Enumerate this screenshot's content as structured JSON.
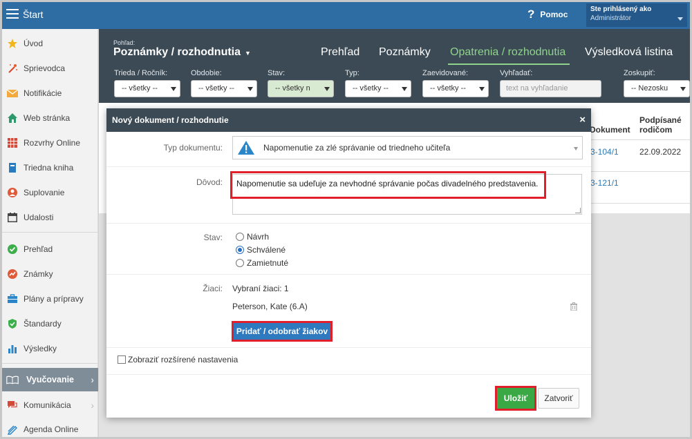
{
  "topbar": {
    "start_label": "Štart",
    "help_label": "Pomoc",
    "help_icon": "?",
    "user_line1": "Ste prihlásený ako",
    "user_line2": "Administrátor"
  },
  "sidebar": {
    "items": [
      {
        "label": "Úvod",
        "icon": "star-icon"
      },
      {
        "label": "Sprievodca",
        "icon": "wand-icon"
      },
      {
        "label": "Notifikácie",
        "icon": "envelope-icon"
      },
      {
        "label": "Web stránka",
        "icon": "house-icon"
      },
      {
        "label": "Rozvrhy Online",
        "icon": "calendar-grid-icon"
      },
      {
        "label": "Triedna kniha",
        "icon": "book-icon"
      },
      {
        "label": "Suplovanie",
        "icon": "person-swap-icon"
      },
      {
        "label": "Udalosti",
        "icon": "calendar-icon"
      },
      {
        "label": "Prehľad",
        "icon": "check-circle-icon"
      },
      {
        "label": "Známky",
        "icon": "grade-icon"
      },
      {
        "label": "Plány a prípravy",
        "icon": "briefcase-icon"
      },
      {
        "label": "Štandardy",
        "icon": "shield-check-icon"
      },
      {
        "label": "Výsledky",
        "icon": "bar-chart-icon"
      },
      {
        "label": "Vyučovanie",
        "icon": "open-book-icon"
      },
      {
        "label": "Komunikácia",
        "icon": "chat-icon"
      },
      {
        "label": "Agenda Online",
        "icon": "pen-icon"
      }
    ]
  },
  "header": {
    "view_label": "Pohľad:",
    "view_value": "Poznámky / rozhodnutia",
    "tabs": [
      "Prehľad",
      "Poznámky",
      "Opatrenia / rozhodnutia",
      "Výsledková listina"
    ],
    "active_tab": "Opatrenia / rozhodnutia",
    "filters": [
      {
        "label": "Trieda / Ročník:",
        "value": "-- všetky --"
      },
      {
        "label": "Obdobie:",
        "value": "-- všetky --"
      },
      {
        "label": "Stav:",
        "value": "-- všetky n"
      },
      {
        "label": "Typ:",
        "value": "-- všetky --"
      },
      {
        "label": "Zaevidované:",
        "value": "-- všetky --"
      }
    ],
    "search_label": "Vyhľadať:",
    "search_placeholder": "text na vyhľadanie",
    "group_label": "Zoskupiť:",
    "group_value": "-- Nezosku"
  },
  "table": {
    "col_document": "Dokument",
    "col_signed_line1": "Podpísané",
    "col_signed_line2": "rodičom",
    "rows": [
      {
        "doc": "3-104/1",
        "signed": "22.09.2022"
      },
      {
        "doc": "3-121/1",
        "signed": ""
      }
    ]
  },
  "modal": {
    "title": "Nový dokument / rozhodnutie",
    "close_icon": "×",
    "doc_type_label": "Typ dokumentu:",
    "doc_type_value": "Napomenutie za zlé správanie od triedneho učiteľa",
    "reason_label": "Dôvod:",
    "reason_value": "Napomenutie sa udeľuje za nevhodné správanie počas divadelného predstavenia.",
    "status_label": "Stav:",
    "status_options": [
      "Návrh",
      "Schválené",
      "Zamietnuté"
    ],
    "status_selected": "Schválené",
    "students_label": "Žiaci:",
    "students_selected": "Vybraní žiaci: 1",
    "student_name": "Peterson, Kate (6.A)",
    "students_button": "Pridať / odobrať žiakov",
    "advanced_label": "Zobraziť rozšírené nastavenia",
    "save_button": "Uložiť",
    "close_button": "Zatvoriť"
  },
  "colors": {
    "topbar": "#2e6da4",
    "header": "#3b4a55",
    "active_tab": "#8fd48a",
    "highlight": "#e11f2a",
    "save": "#3aa845",
    "primary": "#2f79bf"
  }
}
